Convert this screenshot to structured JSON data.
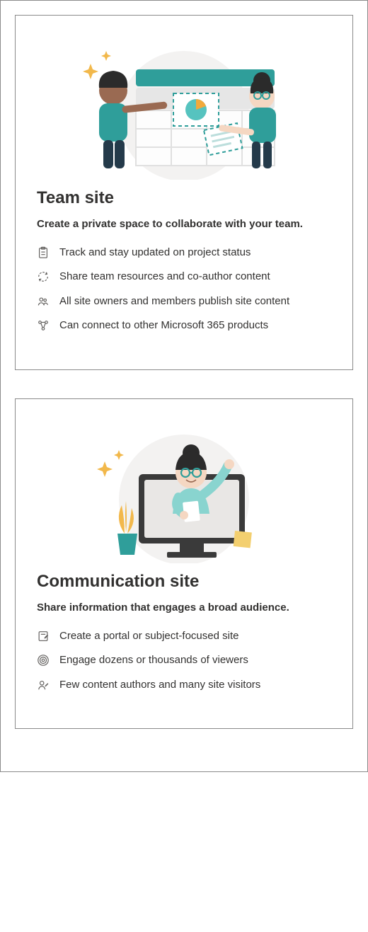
{
  "cards": {
    "team": {
      "title": "Team site",
      "subtitle": "Create a private space to collaborate with your team.",
      "items": [
        "Track and stay updated on project status",
        "Share team resources and co-author content",
        "All site owners and members publish site content",
        "Can connect to other Microsoft 365 products"
      ]
    },
    "communication": {
      "title": "Communication site",
      "subtitle": "Share information that engages a broad audience.",
      "items": [
        "Create a portal or subject-focused site",
        "Engage dozens or thousands of viewers",
        "Few content authors and many site visitors"
      ]
    }
  }
}
